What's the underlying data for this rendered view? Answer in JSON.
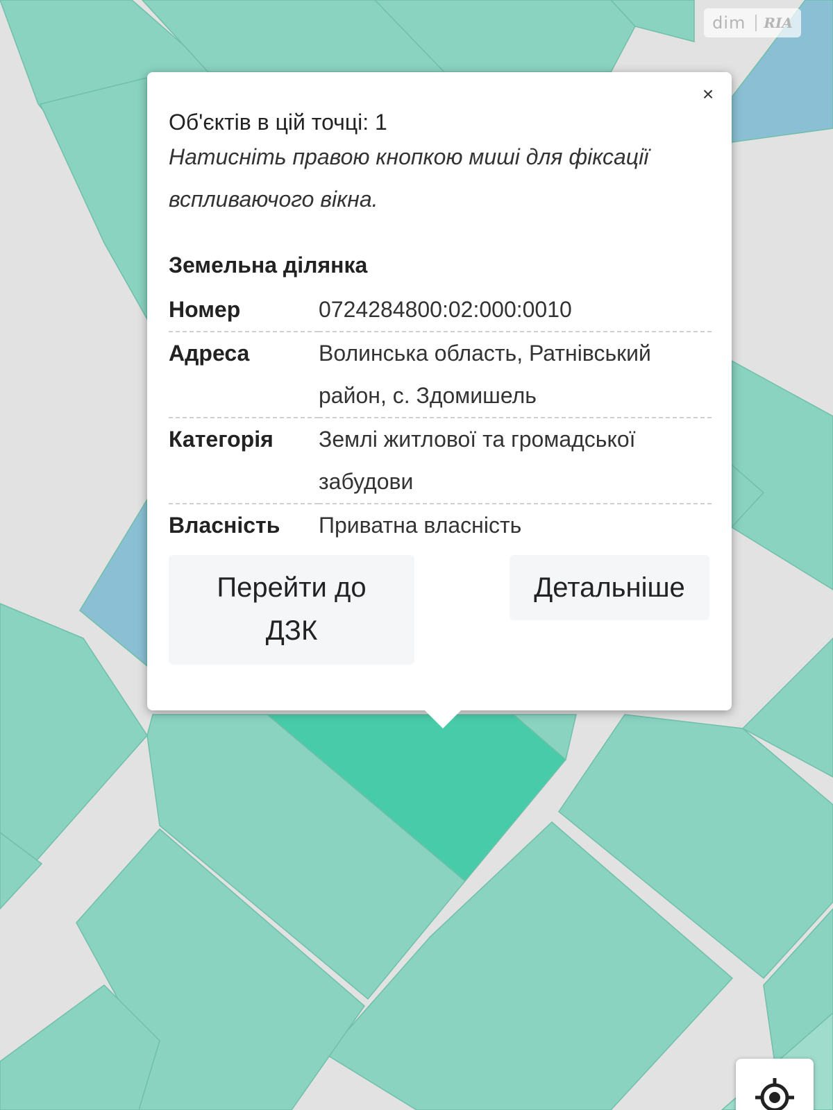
{
  "watermark": {
    "text": "dim",
    "brand": "RIA"
  },
  "popup": {
    "close_symbol": "×",
    "count_text": "Об'єктів в цій точці: 1",
    "hint_line_1": "Натисніть правою кнопкою миші для фіксації",
    "hint_line_2": "вспливаючого вікна.",
    "section_title": "Земельна ділянка",
    "attributes": [
      {
        "key": "Номер",
        "value": "0724284800:02:000:0010"
      },
      {
        "key": "Адреса",
        "value_line_1": "Волинська область, Ратнівський",
        "value_line_2": "район, с. Здомишель"
      },
      {
        "key": "Категорія",
        "value_line_1": "Землі житлової та громадської",
        "value_line_2": "забудови"
      },
      {
        "key": "Власність",
        "value": "Приватна власність"
      }
    ],
    "buttons": {
      "dzk_line_1": "Перейти до",
      "dzk_line_2": "ДЗК",
      "more": "Детальніше"
    }
  },
  "colors": {
    "map_background": "#e2e2e2",
    "parcel": "#8ad3c1",
    "parcel_selected": "#48cba9",
    "water": "#8bbfd4"
  },
  "icons": {
    "close": "close-icon",
    "locate": "crosshair-icon"
  }
}
